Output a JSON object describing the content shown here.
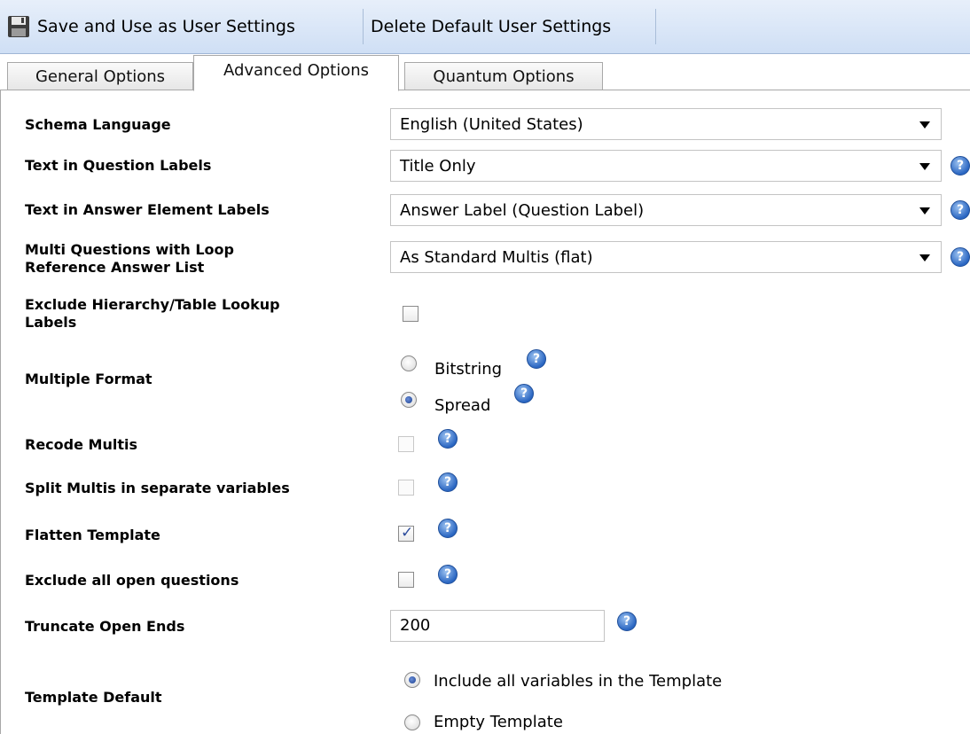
{
  "toolbar": {
    "save_label": "Save and Use as User Settings",
    "delete_label": "Delete Default User Settings"
  },
  "tabs": [
    {
      "label": "General Options",
      "active": false
    },
    {
      "label": "Advanced Options",
      "active": true
    },
    {
      "label": "Quantum Options",
      "active": false
    }
  ],
  "form": {
    "schema_language": {
      "label": "Schema Language",
      "value": "English (United States)"
    },
    "question_labels": {
      "label": "Text in Question Labels",
      "value": "Title Only"
    },
    "answer_labels": {
      "label": "Text in Answer Element Labels",
      "value": "Answer Label (Question Label)"
    },
    "multi_loop": {
      "label_line1": "Multi Questions with Loop",
      "label_line2": "Reference Answer List",
      "value": "As Standard Multis (flat)"
    },
    "exclude_hierarchy": {
      "label_line1": "Exclude Hierarchy/Table Lookup",
      "label_line2": "Labels",
      "checked": false
    },
    "multiple_format": {
      "label": "Multiple Format",
      "options": [
        "Bitstring",
        "Spread"
      ],
      "selected": "Spread"
    },
    "recode_multis": {
      "label": "Recode Multis",
      "checked": false
    },
    "split_multis": {
      "label": "Split Multis in separate variables",
      "checked": false
    },
    "flatten_template": {
      "label": "Flatten Template",
      "checked": true
    },
    "exclude_open": {
      "label": "Exclude all open questions",
      "checked": false
    },
    "truncate_open_ends": {
      "label": "Truncate Open Ends",
      "value": "200"
    },
    "template_default": {
      "label": "Template Default",
      "options": [
        "Include all variables in the Template",
        "Empty Template"
      ],
      "selected": "Include all variables in the Template"
    }
  },
  "help_glyph": "?",
  "check_glyph": "✓",
  "icons": [
    "save-icon",
    "help-icon",
    "dropdown-arrow-icon"
  ]
}
